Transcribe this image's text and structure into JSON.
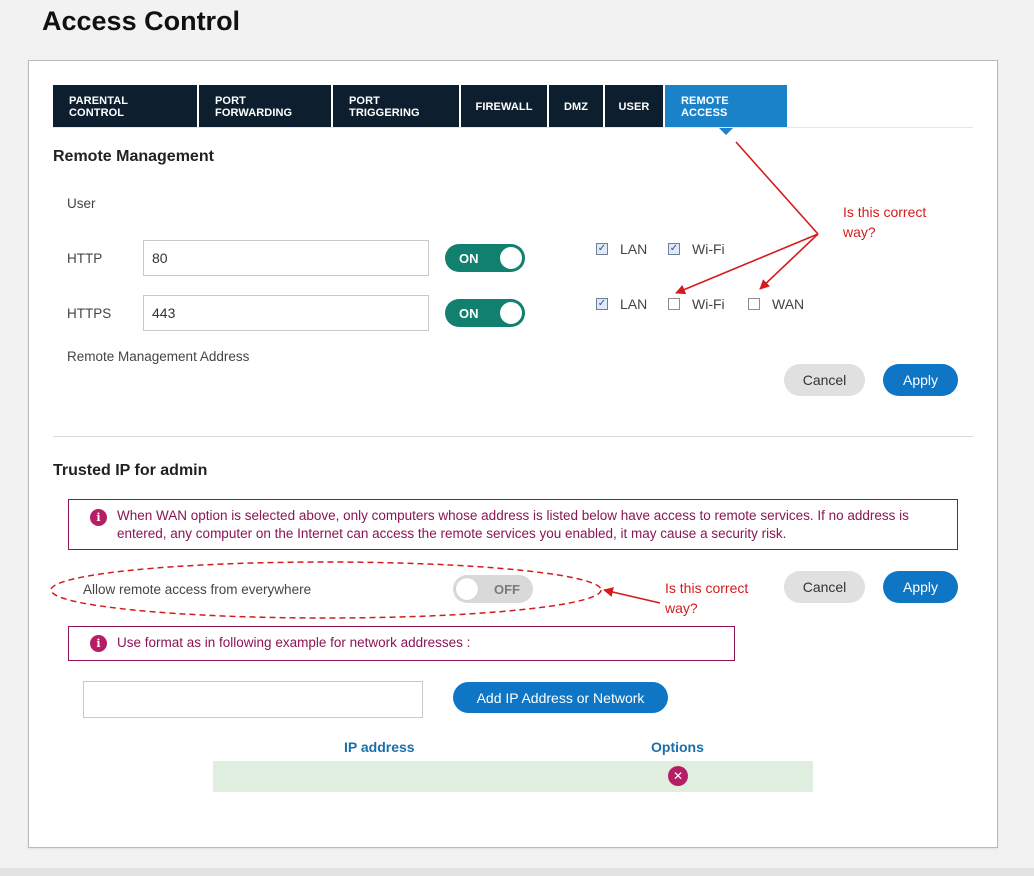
{
  "page": {
    "title": "Access Control"
  },
  "tabs": [
    {
      "label": "PARENTAL CONTROL"
    },
    {
      "label": "PORT FORWARDING"
    },
    {
      "label": "PORT TRIGGERING"
    },
    {
      "label": "FIREWALL"
    },
    {
      "label": "DMZ"
    },
    {
      "label": "USER"
    },
    {
      "label": "REMOTE ACCESS",
      "active": true
    }
  ],
  "remote_management": {
    "title": "Remote Management",
    "user_label": "User",
    "http": {
      "label": "HTTP",
      "value": "80",
      "toggle": "ON",
      "checks": [
        {
          "label": "LAN",
          "checked": true
        },
        {
          "label": "Wi-Fi",
          "checked": true
        }
      ]
    },
    "https": {
      "label": "HTTPS",
      "value": "443",
      "toggle": "ON",
      "checks": [
        {
          "label": "LAN",
          "checked": true
        },
        {
          "label": "Wi-Fi",
          "checked": false
        },
        {
          "label": "WAN",
          "checked": false
        }
      ]
    },
    "address_label": "Remote Management Address",
    "cancel_label": "Cancel",
    "apply_label": "Apply"
  },
  "trusted_ip": {
    "title": "Trusted IP for admin",
    "warning": "When WAN option is selected above, only computers whose address is listed below have access to remote services. If no address is entered, any computer on the Internet can access the remote services you enabled, it may cause a security risk.",
    "allow_label": "Allow remote access from everywhere",
    "allow_toggle": "OFF",
    "cancel_label": "Cancel",
    "apply_label": "Apply",
    "format_notice": "Use format as in following example for network addresses :",
    "ip_input_value": "",
    "add_button_label": "Add IP Address or Network",
    "table": {
      "columns": [
        "IP address",
        "Options"
      ],
      "rows": [
        {
          "ip": ""
        }
      ]
    }
  },
  "annotations": {
    "top": "Is this correct way?",
    "bottom": "Is this correct way?"
  },
  "colors": {
    "tab_dark": "#0d1f2e",
    "tab_active": "#1a82c8",
    "toggle_on": "#12806f",
    "apply": "#0e76c4",
    "notice": "#8b1555",
    "annotation": "#d41c1c",
    "table_row": "#e0eedf"
  },
  "icons": {
    "info": "info-icon",
    "delete": "delete-icon",
    "check": "check-icon"
  }
}
